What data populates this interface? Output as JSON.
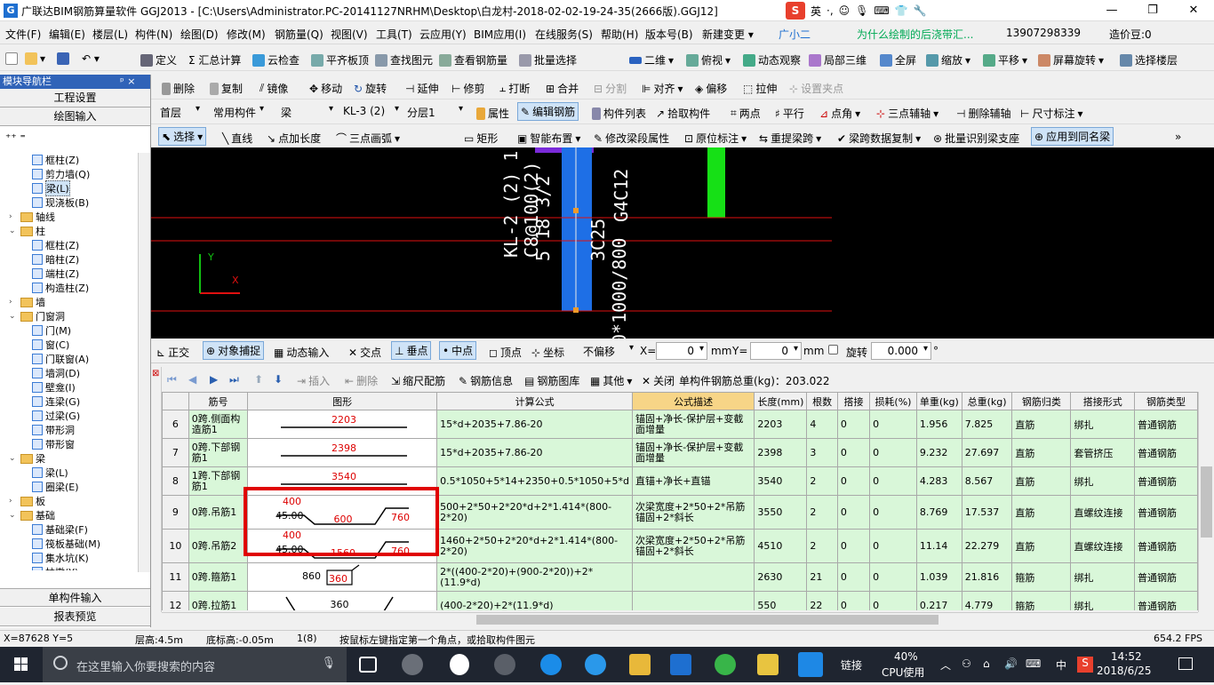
{
  "titlebar": {
    "title": "广联达BIM钢筋算量软件 GGJ2013 - [C:\\Users\\Administrator.PC-20141127NRHM\\Desktop\\白龙村-2018-02-02-19-24-35(2666版).GGJ12]",
    "app_icon": "G",
    "ime_label": "英",
    "ime_logo": "S"
  },
  "menubar": {
    "items": [
      "文件(F)",
      "编辑(E)",
      "楼层(L)",
      "构件(N)",
      "绘图(D)",
      "修改(M)",
      "钢筋量(Q)",
      "视图(V)",
      "工具(T)",
      "云应用(Y)",
      "BIM应用(I)",
      "在线服务(S)",
      "帮助(H)",
      "版本号(B)"
    ],
    "new_change": "新建变更",
    "assistant": "广小二",
    "marquee": "为什么绘制的后浇带汇...",
    "phone": "13907298339",
    "beans": "造价豆:0"
  },
  "toolbar1": {
    "items": [
      "定义",
      "Σ 汇总计算",
      "云检查",
      "平齐板顶",
      "查找图元",
      "查看钢筋量",
      "批量选择",
      "二维",
      "俯视",
      "动态观察",
      "局部三维",
      "全屏",
      "缩放",
      "平移",
      "屏幕旋转",
      "选择楼层"
    ]
  },
  "toolbar2": {
    "items": [
      "删除",
      "复制",
      "镜像",
      "移动",
      "旋转",
      "延伸",
      "修剪",
      "打断",
      "合并",
      "分割",
      "对齐",
      "偏移",
      "拉伸",
      "设置夹点"
    ]
  },
  "toolbar3": {
    "floor": "首层",
    "category": "常用构件",
    "type": "梁",
    "element": "KL-3 (2)",
    "layer": "分层1",
    "items": [
      "属性",
      "编辑钢筋",
      "构件列表",
      "拾取构件",
      "两点",
      "平行",
      "点角",
      "三点辅轴",
      "删除辅轴",
      "尺寸标注"
    ]
  },
  "toolbar4": {
    "items": [
      "选择",
      "直线",
      "点加长度",
      "三点画弧",
      "矩形",
      "智能布置",
      "修改梁段属性",
      "原位标注",
      "重提梁跨",
      "梁跨数据复制",
      "批量识别梁支座",
      "应用到同名梁"
    ]
  },
  "leftpanel": {
    "header": "模块导航栏",
    "pin": "ᵖ ×",
    "tab1": "工程设置",
    "tab2": "绘图输入",
    "bottom1": "单构件输入",
    "bottom2": "报表预览",
    "tree": [
      {
        "label": "框柱(Z)",
        "level": 3,
        "kind": "leaf"
      },
      {
        "label": "剪力墙(Q)",
        "level": 3,
        "kind": "leaf"
      },
      {
        "label": "梁(L)",
        "level": 3,
        "kind": "leaf",
        "selected": true
      },
      {
        "label": "现浇板(B)",
        "level": 3,
        "kind": "leaf"
      },
      {
        "label": "轴线",
        "level": 1,
        "kind": "folder",
        "toggle": "›"
      },
      {
        "label": "柱",
        "level": 1,
        "kind": "folder",
        "toggle": "⌄"
      },
      {
        "label": "框柱(Z)",
        "level": 3,
        "kind": "leaf"
      },
      {
        "label": "暗柱(Z)",
        "level": 3,
        "kind": "leaf"
      },
      {
        "label": "端柱(Z)",
        "level": 3,
        "kind": "leaf"
      },
      {
        "label": "构造柱(Z)",
        "level": 3,
        "kind": "leaf"
      },
      {
        "label": "墙",
        "level": 1,
        "kind": "folder",
        "toggle": "›"
      },
      {
        "label": "门窗洞",
        "level": 1,
        "kind": "folder",
        "toggle": "⌄"
      },
      {
        "label": "门(M)",
        "level": 3,
        "kind": "leaf"
      },
      {
        "label": "窗(C)",
        "level": 3,
        "kind": "leaf"
      },
      {
        "label": "门联窗(A)",
        "level": 3,
        "kind": "leaf"
      },
      {
        "label": "墙洞(D)",
        "level": 3,
        "kind": "leaf"
      },
      {
        "label": "壁龛(I)",
        "level": 3,
        "kind": "leaf"
      },
      {
        "label": "连梁(G)",
        "level": 3,
        "kind": "leaf"
      },
      {
        "label": "过梁(G)",
        "level": 3,
        "kind": "leaf"
      },
      {
        "label": "带形洞",
        "level": 3,
        "kind": "leaf"
      },
      {
        "label": "带形窗",
        "level": 3,
        "kind": "leaf"
      },
      {
        "label": "梁",
        "level": 1,
        "kind": "folder",
        "toggle": "⌄"
      },
      {
        "label": "梁(L)",
        "level": 3,
        "kind": "leaf"
      },
      {
        "label": "圈梁(E)",
        "level": 3,
        "kind": "leaf"
      },
      {
        "label": "板",
        "level": 1,
        "kind": "folder",
        "toggle": "›"
      },
      {
        "label": "基础",
        "level": 1,
        "kind": "folder",
        "toggle": "⌄"
      },
      {
        "label": "基础梁(F)",
        "level": 3,
        "kind": "leaf"
      },
      {
        "label": "筏板基础(M)",
        "level": 3,
        "kind": "leaf"
      },
      {
        "label": "集水坑(K)",
        "level": 3,
        "kind": "leaf"
      },
      {
        "label": "柱墩(Y)",
        "level": 3,
        "kind": "leaf"
      }
    ]
  },
  "canvas": {
    "text_kl": "KL-2 (2) 1",
    "text_stirrup": "C8@100(2)",
    "text_bottom": "5 18 3/2",
    "text_top": "3C25",
    "text_side": "G4C12",
    "text_size": "0*1000/800",
    "axis_x": "X",
    "axis_y": "Y"
  },
  "snapbar": {
    "items": [
      "正交",
      "对象捕捉",
      "动态输入",
      "交点",
      "垂点",
      "中点",
      "顶点",
      "坐标"
    ],
    "offset": "不偏移",
    "x_label": "X=",
    "x_value": "0",
    "y_label": "Y=",
    "y_value": "0",
    "unit": "mm",
    "rotate_label": "旋转",
    "rotate_value": "0.000",
    "deg": "°"
  },
  "gridtoolbar": {
    "items": [
      "插入",
      "删除",
      "缩尺配筋",
      "钢筋信息",
      "钢筋图库",
      "其他",
      "关闭"
    ],
    "total_label": "单构件钢筋总重(kg)：203.022"
  },
  "grid": {
    "headers": [
      "",
      "筋号",
      "图形",
      "计算公式",
      "公式描述",
      "长度(mm)",
      "根数",
      "搭接",
      "损耗(%)",
      "单重(kg)",
      "总重(kg)",
      "钢筋归类",
      "搭接形式",
      "钢筋类型"
    ],
    "rows": [
      {
        "idx": "6",
        "name": "0跨.侧面构造筋1",
        "fig_a": "2203",
        "formula": "15*d+2035+7.86-20",
        "desc": "锚固+净长-保护层+变截面增量",
        "len": "2203",
        "count": "4",
        "lap": "0",
        "loss": "0",
        "unit_w": "1.956",
        "total_w": "7.825",
        "cat": "直筋",
        "lap_form": "绑扎",
        "type": "普通钢筋"
      },
      {
        "idx": "7",
        "name": "0跨.下部钢筋1",
        "fig_a": "2398",
        "formula": "15*d+2035+7.86-20",
        "desc": "锚固+净长-保护层+变截面增量",
        "len": "2398",
        "count": "3",
        "lap": "0",
        "loss": "0",
        "unit_w": "9.232",
        "total_w": "27.697",
        "cat": "直筋",
        "lap_form": "套管挤压",
        "type": "普通钢筋"
      },
      {
        "idx": "8",
        "name": "1跨.下部钢筋1",
        "fig_a": "3540",
        "formula": "0.5*1050+5*14+2350+0.5*1050+5*d",
        "desc": "直锚+净长+直锚",
        "len": "3540",
        "count": "2",
        "lap": "0",
        "loss": "0",
        "unit_w": "4.283",
        "total_w": "8.567",
        "cat": "直筋",
        "lap_form": "绑扎",
        "type": "普通钢筋"
      },
      {
        "idx": "9",
        "name": "0跨.吊筋1",
        "fig_a": "400",
        "fig_b": "45.00",
        "fig_c": "600",
        "fig_d": "760",
        "formula": "500+2*50+2*20*d+2*1.414*(800-2*20)",
        "desc": "次梁宽度+2*50+2*吊筋锚固+2*斜长",
        "len": "3550",
        "count": "2",
        "lap": "0",
        "loss": "0",
        "unit_w": "8.769",
        "total_w": "17.537",
        "cat": "直筋",
        "lap_form": "直螺纹连接",
        "type": "普通钢筋"
      },
      {
        "idx": "10",
        "name": "0跨.吊筋2",
        "fig_a": "400",
        "fig_b": "45.00",
        "fig_c": "1560",
        "fig_d": "760",
        "formula": "1460+2*50+2*20*d+2*1.414*(800-2*20)",
        "desc": "次梁宽度+2*50+2*吊筋锚固+2*斜长",
        "len": "4510",
        "count": "2",
        "lap": "0",
        "loss": "0",
        "unit_w": "11.14",
        "total_w": "22.279",
        "cat": "直筋",
        "lap_form": "直螺纹连接",
        "type": "普通钢筋"
      },
      {
        "idx": "11",
        "name": "0跨.箍筋1",
        "fig_a": "860",
        "fig_b": "360",
        "formula": "2*((400-2*20)+(900-2*20))+2*(11.9*d)",
        "desc": "",
        "len": "2630",
        "count": "21",
        "lap": "0",
        "loss": "0",
        "unit_w": "1.039",
        "total_w": "21.816",
        "cat": "箍筋",
        "lap_form": "绑扎",
        "type": "普通钢筋"
      },
      {
        "idx": "12",
        "name": "0跨.拉筋1",
        "fig_a": "360",
        "formula": "(400-2*20)+2*(11.9*d)",
        "desc": "",
        "len": "550",
        "count": "22",
        "lap": "0",
        "loss": "0",
        "unit_w": "0.217",
        "total_w": "4.779",
        "cat": "箍筋",
        "lap_form": "绑扎",
        "type": "普通钢筋"
      }
    ]
  },
  "statusbar": {
    "coords": "X=87628 Y=5",
    "floor_h": "层高:4.5m",
    "base_h": "底标高:-0.05m",
    "count": "1(8)",
    "hint": "按鼠标左键指定第一个角点，或拾取构件图元",
    "fps": "654.2 FPS"
  },
  "taskbar": {
    "search_placeholder": "在这里输入你要搜索的内容",
    "link": "链接",
    "cpu_pct": "40%",
    "cpu_label": "CPU使用",
    "lang": "中",
    "time": "14:52",
    "date": "2018/6/25"
  },
  "colors": {
    "accent": "#3063b8",
    "grid_green": "#d9f7d9",
    "highlight_red": "#e00000",
    "canvas_bg": "#000000"
  }
}
